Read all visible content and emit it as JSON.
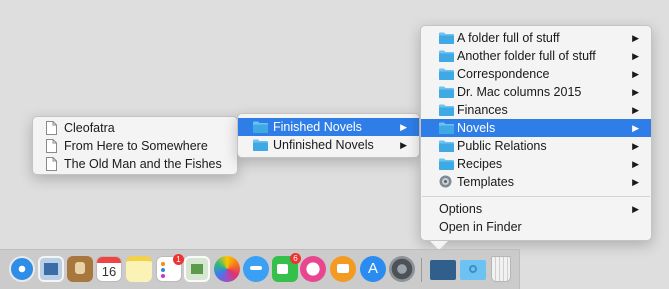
{
  "documents_menu": {
    "items": [
      "Cleofatra",
      "From Here to Somewhere",
      "The Old Man and the Fishes"
    ]
  },
  "novels_menu": {
    "items": [
      "Finished Novels",
      "Unfinished Novels"
    ],
    "highlighted": "Finished Novels"
  },
  "stack_menu": {
    "folders": [
      "A folder full of stuff",
      "Another folder full of stuff",
      "Correspondence",
      "Dr. Mac columns 2015",
      "Finances",
      "Novels",
      "Public Relations",
      "Recipes",
      "Templates"
    ],
    "highlighted": "Novels",
    "options_label": "Options",
    "open_in_finder_label": "Open in Finder"
  },
  "dock": {
    "calendar_day": "16",
    "reminders_badge": "1",
    "facetime_badge": "6",
    "apps": [
      "safari-icon",
      "photos-preview-icon",
      "contacts-icon",
      "calendar-icon",
      "notes-icon",
      "reminders-icon",
      "preview-icon",
      "photos-icon",
      "messages-icon",
      "facetime-icon",
      "itunes-icon",
      "ibooks-icon",
      "app-store-icon",
      "system-preferences-icon",
      "documents-stack-icon",
      "folder-stack-icon",
      "trash-icon"
    ]
  },
  "colors": {
    "highlight": "#2f7ee8",
    "folder": "#3fa9e3",
    "menu_bg": "#f4f4f4",
    "desktop": "#dedede"
  }
}
